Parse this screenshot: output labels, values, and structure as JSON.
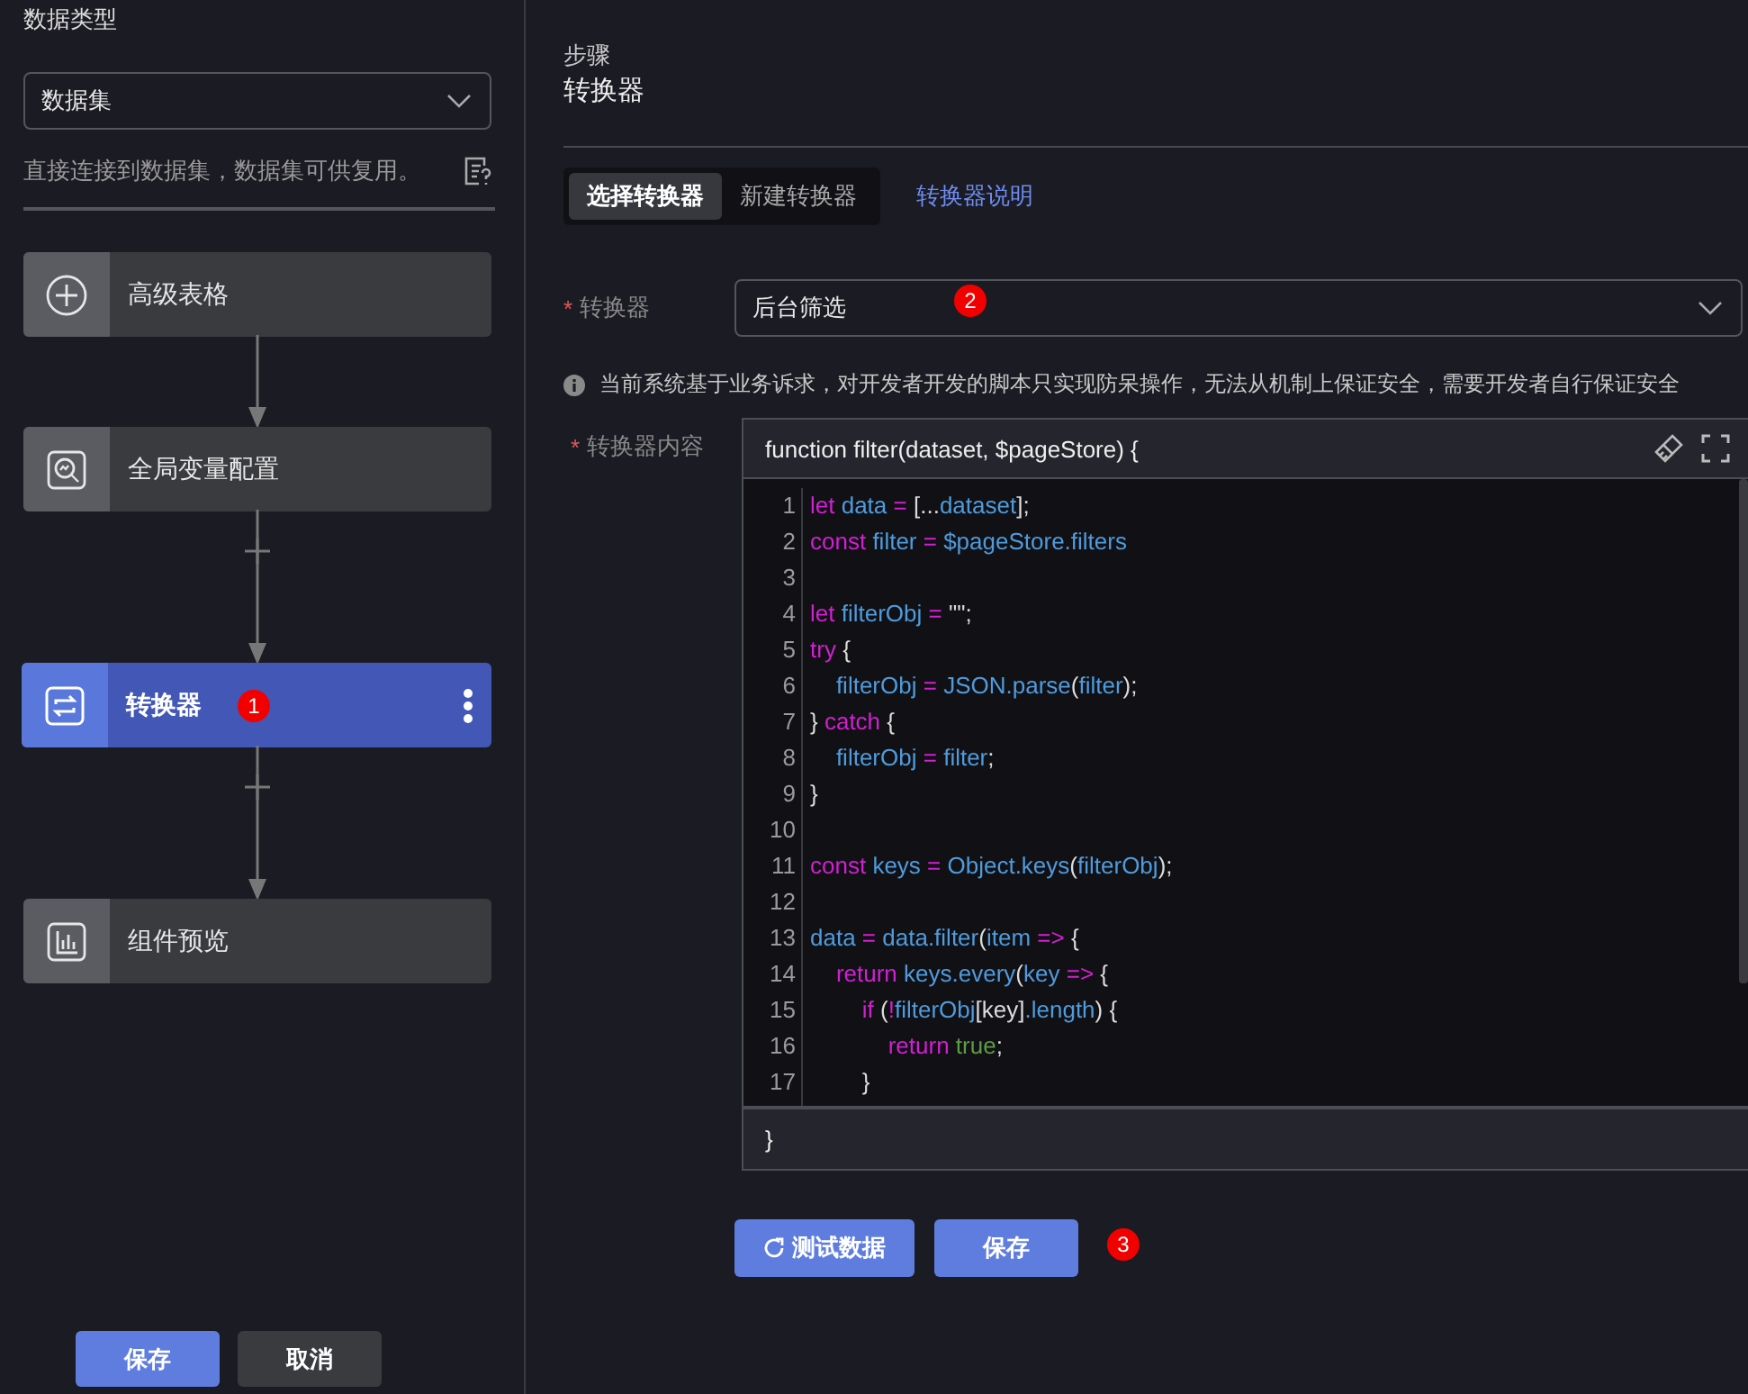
{
  "sidebar": {
    "title": "数据类型",
    "source_select": {
      "value": "数据集"
    },
    "help_text": "直接连接到数据集，数据集可供复用。",
    "steps": [
      {
        "label": "高级表格",
        "kind": "plus",
        "selected": false
      },
      {
        "label": "全局变量配置",
        "kind": "search",
        "selected": false,
        "insert_button": false
      },
      {
        "label": "转换器",
        "kind": "swap",
        "selected": true,
        "insert_button": true,
        "badge": "1"
      },
      {
        "label": "组件预览",
        "kind": "chart",
        "selected": false,
        "insert_button": true
      }
    ],
    "buttons": [
      {
        "label": "保存",
        "kind": "primary"
      },
      {
        "label": "取消",
        "kind": "secondary"
      }
    ]
  },
  "main": {
    "eyebrow": "步骤",
    "title": "转换器",
    "tabs": [
      {
        "label": "选择转换器",
        "selected": true
      },
      {
        "label": "新建转换器",
        "selected": false
      }
    ],
    "help_link": "转换器说明",
    "converter_field": {
      "label": "转换器",
      "required_mark": "*",
      "value": "后台筛选",
      "badge": "2"
    },
    "notice": "当前系统基于业务诉求，对开发者开发的脚本只实现防呆操作，无法从机制上保证安全，需要开发者自行保证安全",
    "code_field": {
      "label": "转换器内容",
      "required_mark": "*",
      "header": "function filter(dataset, $pageStore) {",
      "footer": "}",
      "lines": [
        {
          "number": "1",
          "tokens": [
            {
              "kind": "kw",
              "text": "let"
            },
            {
              "kind": "var",
              "text": " data"
            },
            {
              "kind": "kw",
              "text": " ="
            },
            {
              "kind": "plain",
              "text": " [..."
            },
            {
              "kind": "var",
              "text": "dataset"
            },
            {
              "kind": "plain",
              "text": "];"
            }
          ]
        },
        {
          "number": "2",
          "tokens": [
            {
              "kind": "kw",
              "text": "const"
            },
            {
              "kind": "var",
              "text": " filter"
            },
            {
              "kind": "kw",
              "text": " ="
            },
            {
              "kind": "var",
              "text": " $pageStore.filters"
            }
          ]
        },
        {
          "number": "3"
        },
        {
          "number": "4",
          "tokens": [
            {
              "kind": "kw",
              "text": "let"
            },
            {
              "kind": "var",
              "text": " filterObj"
            },
            {
              "kind": "kw",
              "text": " ="
            },
            {
              "kind": "plain",
              "text": " \"\";"
            }
          ]
        },
        {
          "number": "5",
          "tokens": [
            {
              "kind": "kw",
              "text": "try"
            },
            {
              "kind": "plain",
              "text": " {"
            }
          ]
        },
        {
          "number": "6",
          "tokens": [
            {
              "kind": "var",
              "text": "    filterObj"
            },
            {
              "kind": "kw",
              "text": " ="
            },
            {
              "kind": "var",
              "text": " JSON.parse"
            },
            {
              "kind": "plain",
              "text": "("
            },
            {
              "kind": "var",
              "text": "filter"
            },
            {
              "kind": "plain",
              "text": ");"
            }
          ]
        },
        {
          "number": "7",
          "tokens": [
            {
              "kind": "plain",
              "text": "} "
            },
            {
              "kind": "kw",
              "text": "catch"
            },
            {
              "kind": "plain",
              "text": " {"
            }
          ]
        },
        {
          "number": "8",
          "tokens": [
            {
              "kind": "var",
              "text": "    filterObj"
            },
            {
              "kind": "kw",
              "text": " ="
            },
            {
              "kind": "var",
              "text": " filter"
            },
            {
              "kind": "plain",
              "text": ";"
            }
          ]
        },
        {
          "number": "9",
          "tokens": [
            {
              "kind": "plain",
              "text": "}"
            }
          ]
        },
        {
          "number": "10"
        },
        {
          "number": "11",
          "tokens": [
            {
              "kind": "kw",
              "text": "const"
            },
            {
              "kind": "var",
              "text": " keys"
            },
            {
              "kind": "kw",
              "text": " ="
            },
            {
              "kind": "var",
              "text": " Object.keys"
            },
            {
              "kind": "plain",
              "text": "("
            },
            {
              "kind": "var",
              "text": "filterObj"
            },
            {
              "kind": "plain",
              "text": ");"
            }
          ]
        },
        {
          "number": "12"
        },
        {
          "number": "13",
          "tokens": [
            {
              "kind": "var",
              "text": "data"
            },
            {
              "kind": "kw",
              "text": " ="
            },
            {
              "kind": "var",
              "text": " data.filter"
            },
            {
              "kind": "plain",
              "text": "("
            },
            {
              "kind": "var",
              "text": "item"
            },
            {
              "kind": "kw",
              "text": " =>"
            },
            {
              "kind": "plain",
              "text": " {"
            }
          ]
        },
        {
          "number": "14",
          "tokens": [
            {
              "kind": "kw",
              "text": "    return"
            },
            {
              "kind": "var",
              "text": " keys.every"
            },
            {
              "kind": "plain",
              "text": "("
            },
            {
              "kind": "var",
              "text": "key"
            },
            {
              "kind": "kw",
              "text": " =>"
            },
            {
              "kind": "plain",
              "text": " {"
            }
          ]
        },
        {
          "number": "15",
          "tokens": [
            {
              "kind": "kw",
              "text": "        if"
            },
            {
              "kind": "plain",
              "text": " ("
            },
            {
              "kind": "kw",
              "text": "!"
            },
            {
              "kind": "var",
              "text": "filterObj"
            },
            {
              "kind": "plain",
              "text": "[key]"
            },
            {
              "kind": "var",
              "text": ".length"
            },
            {
              "kind": "plain",
              "text": ") {"
            }
          ]
        },
        {
          "number": "16",
          "tokens": [
            {
              "kind": "kw",
              "text": "            return"
            },
            {
              "kind": "bool",
              "text": " true"
            },
            {
              "kind": "plain",
              "text": ";"
            }
          ]
        },
        {
          "number": "17",
          "tokens": [
            {
              "kind": "plain",
              "text": "        }"
            }
          ]
        }
      ]
    },
    "buttons": [
      {
        "label": "测试数据",
        "kind": "refresh"
      },
      {
        "label": "保存",
        "kind": "primary"
      }
    ],
    "buttons_badge": "3"
  }
}
